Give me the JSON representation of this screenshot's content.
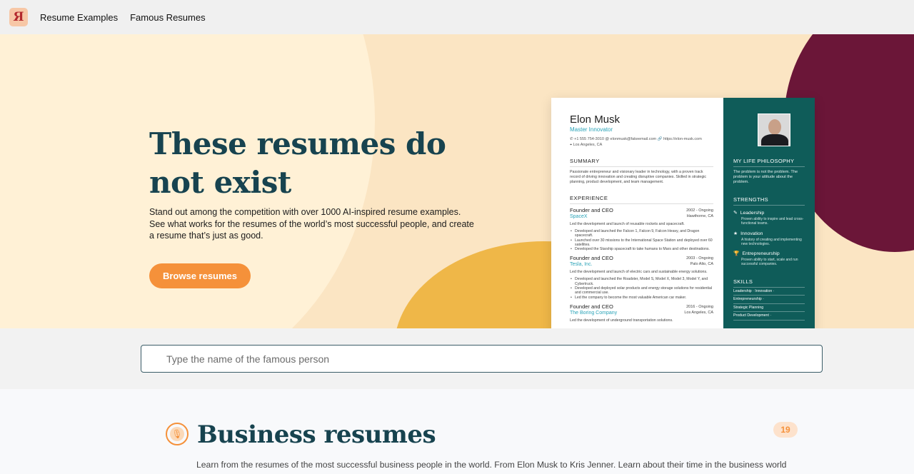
{
  "nav": {
    "logo": "Я",
    "links": [
      "Resume Examples",
      "Famous Resumes"
    ]
  },
  "hero": {
    "title": "These resumes do not exist",
    "subtitle": "Stand out among the competition with over 1000 AI-inspired resume examples. See what works for the resumes of the world’s most successful people, and create a resume that’s just as good.",
    "button": "Browse resumes"
  },
  "resume": {
    "name": "Elon Musk",
    "role": "Master Innovator",
    "contact_line1": "✆ +1 555 754-3010   @ elonmusk@fakeemail.com   🔗 https://elon-musk.com",
    "contact_line2": "⌖ Los Angeles, CA",
    "summary_heading": "SUMMARY",
    "summary": "Passionate entrepreneur and visionary leader in technology, with a proven track record of driving innovation and creating disruptive companies. Skilled in strategic planning, product development, and team management.",
    "experience_heading": "EXPERIENCE",
    "jobs": [
      {
        "title": "Founder and CEO",
        "dates": "2002 - Ongoing",
        "company": "SpaceX",
        "location": "Hawthorne, CA",
        "desc": "Led the development and launch of reusable rockets and spacecraft.",
        "bullets": [
          "Developed and launched the Falcon 1, Falcon 9, Falcon Heavy, and Dragon spacecraft.",
          "Launched over 30 missions to the International Space Station and deployed over 60 satellites.",
          "Developed the Starship spacecraft to take humans to Mars and other destinations."
        ]
      },
      {
        "title": "Founder and CEO",
        "dates": "2003 - Ongoing",
        "company": "Tesla, Inc.",
        "location": "Palo Alto, CA",
        "desc": "Led the development and launch of electric cars and sustainable energy solutions.",
        "bullets": [
          "Developed and launched the Roadster, Model S, Model X, Model 3, Model Y, and Cybertruck.",
          "Developed and deployed solar products and energy storage solutions for residential and commercial use.",
          "Led the company to become the most valuable American car maker."
        ]
      },
      {
        "title": "Founder and CEO",
        "dates": "2016 - Ongoing",
        "company": "The Boring Company",
        "location": "Los Angeles, CA",
        "desc": "Led the development of underground transportation solutions.",
        "bullets": []
      }
    ],
    "philosophy_heading": "MY LIFE PHILOSOPHY",
    "philosophy": "The problem is not the problem. The problem is your attitude about the problem.",
    "strengths_heading": "STRENGTHS",
    "strengths": [
      {
        "icon": "✎",
        "name": "Leadership",
        "desc": "Proven ability to inspire and lead cross-functional teams."
      },
      {
        "icon": "★",
        "name": "Innovation",
        "desc": "A history of creating and implementing new technologies."
      },
      {
        "icon": "🏆",
        "name": "Entrepreneurship",
        "desc": "Proven ability to start, scale and run successful companies."
      }
    ],
    "skills_heading": "SKILLS",
    "skills": [
      "Leadership · Innovation ·",
      "Entrepreneurship ·",
      "Strategic Planning",
      "Product Development ·"
    ]
  },
  "search": {
    "placeholder": "Type the name of the famous person"
  },
  "business": {
    "title": "Business resumes",
    "count": "19",
    "description": "Learn from the resumes of the most successful business people in the world. From Elon Musk to Kris Jenner. Learn about their time in the business world from waste and build their wealth..."
  }
}
